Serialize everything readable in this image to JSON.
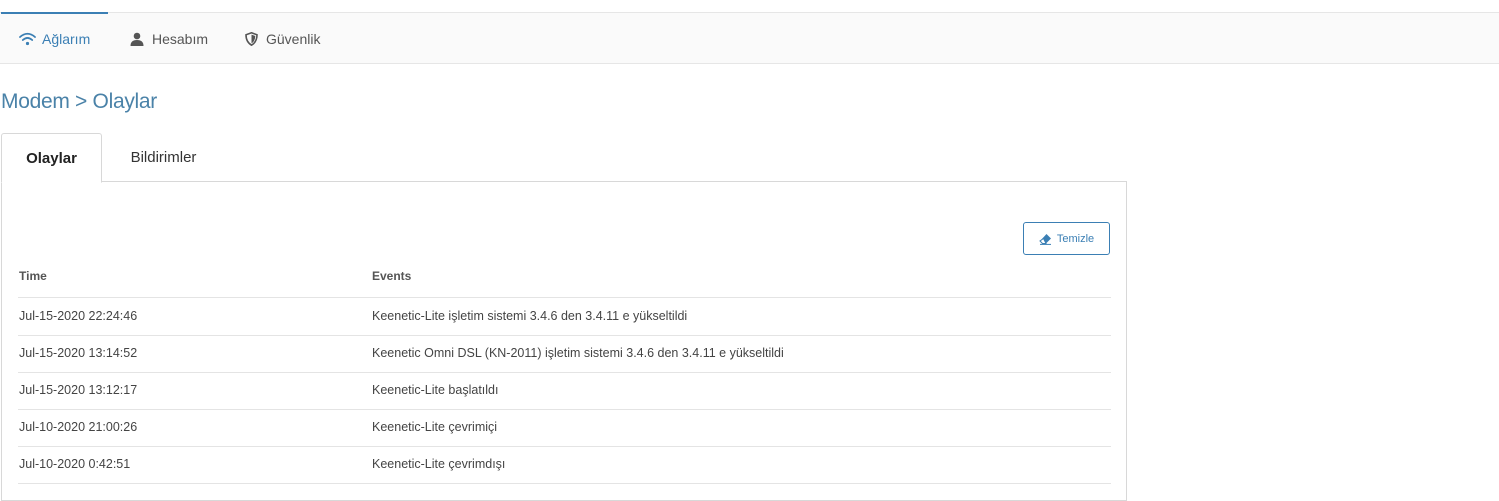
{
  "nav": {
    "items": [
      {
        "label": "Ağlarım",
        "icon": "wifi-icon",
        "active": true
      },
      {
        "label": "Hesabım",
        "icon": "user-icon",
        "active": false
      },
      {
        "label": "Güvenlik",
        "icon": "shield-icon",
        "active": false
      }
    ]
  },
  "page": {
    "title": "Modem > Olaylar"
  },
  "tabs": [
    {
      "label": "Olaylar",
      "active": true
    },
    {
      "label": "Bildirimler",
      "active": false
    }
  ],
  "toolbar": {
    "clear_label": "Temizle",
    "clear_icon": "eraser-icon"
  },
  "table": {
    "columns": [
      "Time",
      "Events"
    ],
    "rows": [
      {
        "time": "Jul-15-2020 22:24:46",
        "event": "Keenetic-Lite işletim sistemi 3.4.6 den 3.4.11 e yükseltildi"
      },
      {
        "time": "Jul-15-2020 13:14:52",
        "event": "Keenetic Omni DSL (KN-2011) işletim sistemi 3.4.6 den 3.4.11 e yükseltildi"
      },
      {
        "time": "Jul-15-2020 13:12:17",
        "event": "Keenetic-Lite başlatıldı"
      },
      {
        "time": "Jul-10-2020 21:00:26",
        "event": "Keenetic-Lite çevrimiçi"
      },
      {
        "time": "Jul-10-2020 0:42:51",
        "event": "Keenetic-Lite çevrimdışı"
      }
    ]
  },
  "colors": {
    "accent": "#3b7fb4",
    "title": "#4a82a8"
  }
}
